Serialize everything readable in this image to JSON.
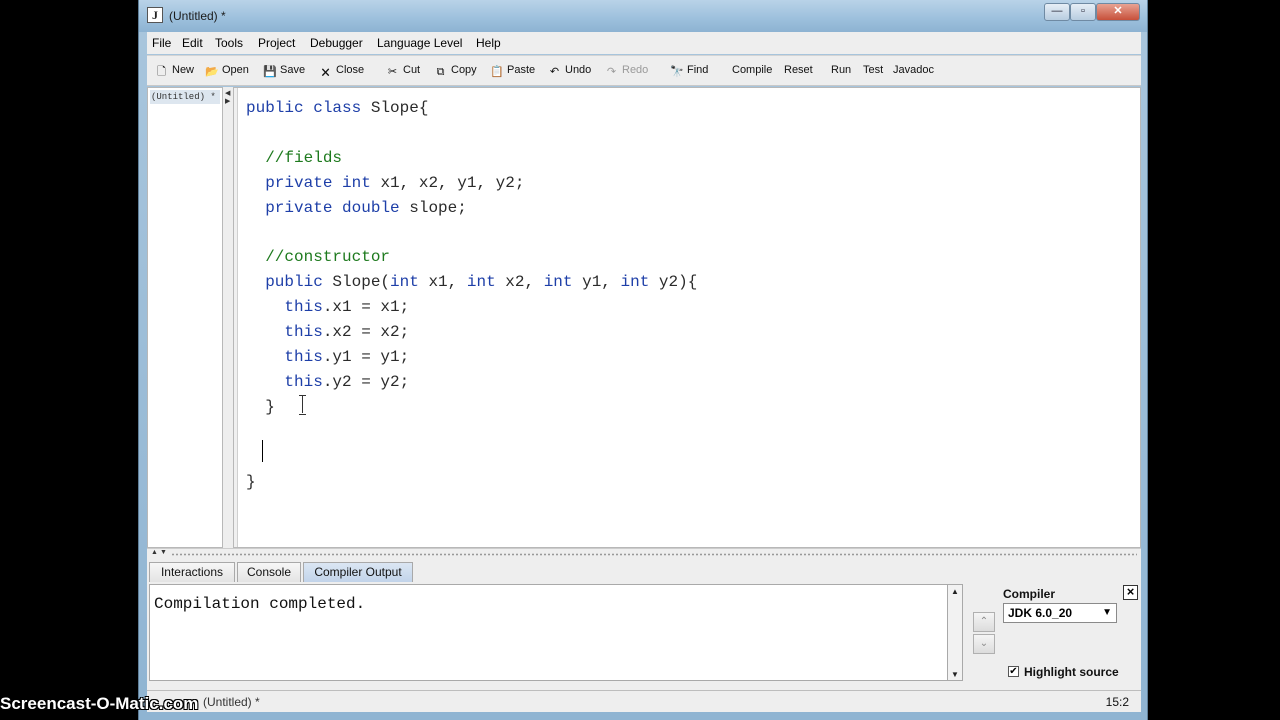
{
  "window": {
    "title": "(Untitled) *",
    "app_icon": "J",
    "controls": {
      "minimize": "—",
      "maximize": "▫",
      "close": "✕"
    }
  },
  "menu": {
    "file": "File",
    "edit": "Edit",
    "tools": "Tools",
    "project": "Project",
    "debugger": "Debugger",
    "language_level": "Language Level",
    "help": "Help"
  },
  "toolbar": {
    "new": "New",
    "open": "Open",
    "save": "Save",
    "close": "Close",
    "cut": "Cut",
    "copy": "Copy",
    "paste": "Paste",
    "undo": "Undo",
    "redo": "Redo",
    "find": "Find",
    "compile": "Compile",
    "reset": "Reset",
    "run": "Run",
    "test": "Test",
    "javadoc": "Javadoc"
  },
  "doclist": {
    "item": "(Untitled) *"
  },
  "editor": {
    "lines": [
      "public class Slope{",
      "",
      "  //fields",
      "  private int x1, x2, y1, y2;",
      "  private double slope;",
      "",
      "  //constructor",
      "  public Slope(int x1, int x2, int y1, int y2){",
      "    this.x1 = x1;",
      "    this.x2 = x2;",
      "    this.y1 = y1;",
      "    this.y2 = y2;",
      "  }",
      "",
      "  ",
      "}"
    ]
  },
  "tabs": {
    "interactions": "Interactions",
    "console": "Console",
    "compiler_output": "Compiler Output",
    "active": "Compiler Output"
  },
  "output": {
    "text": "Compilation completed."
  },
  "compiler": {
    "label": "Compiler",
    "selected": "JDK 6.0_20",
    "highlight_label": "Highlight source",
    "highlight_checked": true
  },
  "status": {
    "file": "(Untitled) *",
    "position": "15:2"
  },
  "watermark": "Screencast-O-Matic.com"
}
